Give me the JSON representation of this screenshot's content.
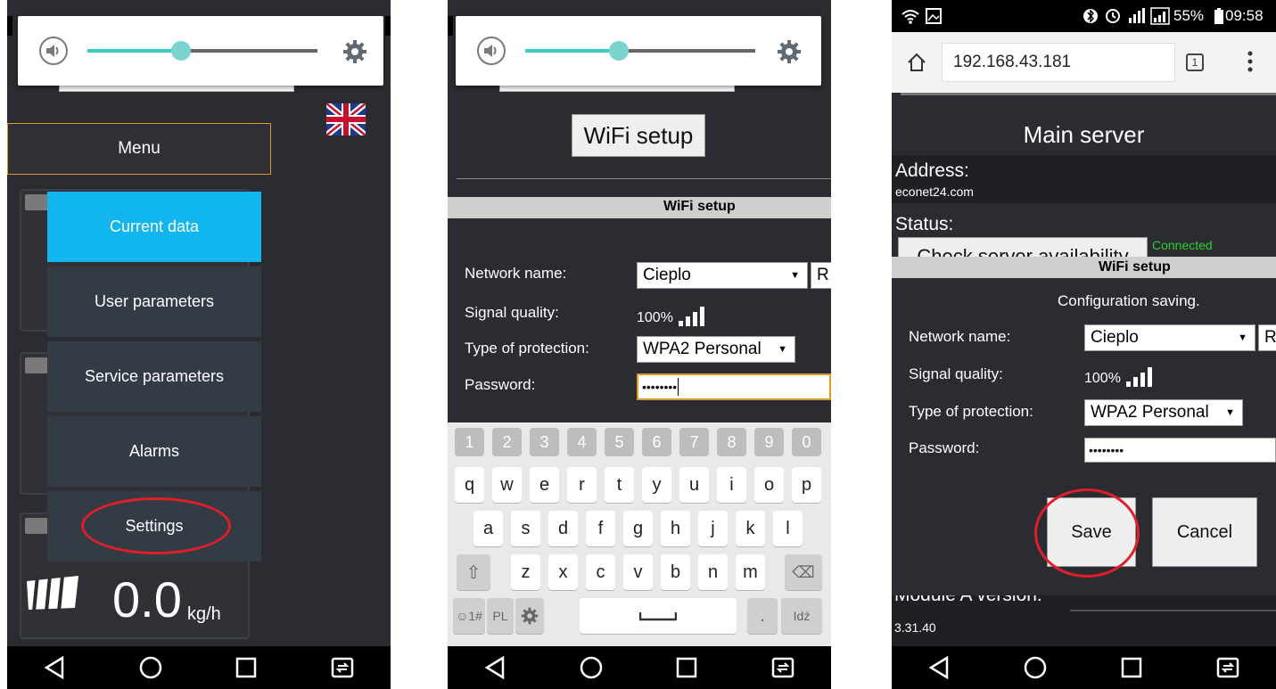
{
  "phone1": {
    "menu_label": "Menu",
    "menu_items": [
      "Current data",
      "User parameters",
      "Service parameters",
      "Alarms",
      "Settings"
    ],
    "fuel_value": "0.0",
    "fuel_unit": "kg/h"
  },
  "phone2": {
    "title_button": "WiFi setup",
    "section_title": "WiFi setup",
    "labels": {
      "network": "Network name:",
      "signal": "Signal quality:",
      "protection": "Type of protection:",
      "password": "Password:"
    },
    "network_value": "Cieplo",
    "refresh_stub": "R",
    "signal_value": "100%",
    "protection_value": "WPA2 Personal",
    "password_value": "••••••••",
    "keyboard": {
      "numbers": [
        "1",
        "2",
        "3",
        "4",
        "5",
        "6",
        "7",
        "8",
        "9",
        "0"
      ],
      "row1": [
        "q",
        "w",
        "e",
        "r",
        "t",
        "y",
        "u",
        "i",
        "o",
        "p"
      ],
      "row2": [
        "a",
        "s",
        "d",
        "f",
        "g",
        "h",
        "j",
        "k",
        "l"
      ],
      "row3": [
        "z",
        "x",
        "c",
        "v",
        "b",
        "n",
        "m"
      ],
      "sym_key": "☺1#",
      "lang_key": "PL",
      "enter_key": "Idź",
      "dot_key": "."
    }
  },
  "phone3": {
    "status_battery": "55%",
    "status_time": "09:58",
    "url": "192.168.43.181",
    "tab_count": "1",
    "main_server_title": "Main server",
    "address_label": "Address:",
    "address_value": "econet24.com",
    "status_label": "Status:",
    "check_button": "Check server availability",
    "connected_text": "Connected",
    "dialog_title": "WiFi setup",
    "saving_text": "Configuration saving.",
    "labels": {
      "network": "Network name:",
      "signal": "Signal quality:",
      "protection": "Type of protection:",
      "password": "Password:"
    },
    "network_value": "Cieplo",
    "refresh_stub": "R",
    "signal_value": "100%",
    "protection_value": "WPA2 Personal",
    "password_value": "••••••••",
    "save_button": "Save",
    "cancel_button": "Cancel",
    "module_label": "Module A version:",
    "module_value": "3.31.40"
  },
  "colors": {
    "accent": "#12b6ee",
    "highlight": "#e21e2a",
    "panel": "#2f3136",
    "connected": "#2dd22d"
  }
}
